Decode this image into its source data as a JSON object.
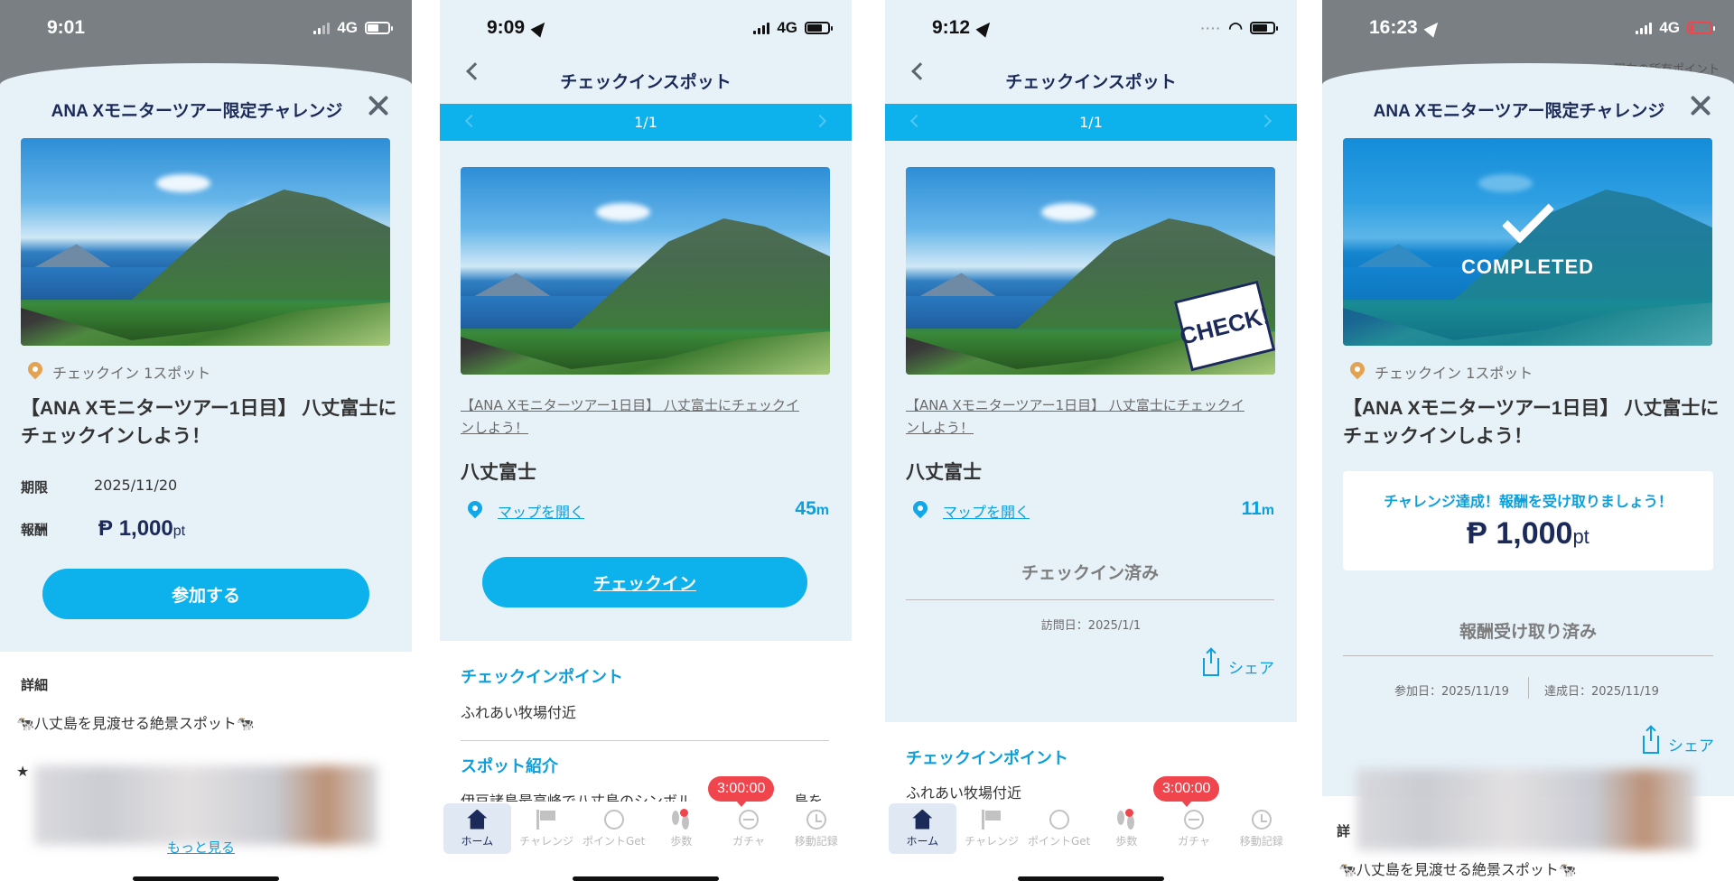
{
  "screens": {
    "join": {
      "time": "9:01",
      "network": "4G",
      "modal_title": "ANA Xモニターツアー限定チャレンジ",
      "spot_count": "チェックイン 1スポット",
      "challenge_title_1": "【ANA Xモニターツアー1日目】 八丈富士に",
      "challenge_title_2": "チェックインしよう！",
      "period_label": "期限",
      "period_value": "2025/11/20",
      "reward_label": "報酬",
      "reward_symbol": "Ᵽ",
      "reward_amount": "1,000",
      "reward_unit": "pt",
      "join_button": "参加する",
      "details_label": "詳細",
      "description": "🐄八丈島を見渡せる絶景スポット🐄",
      "more_link": "もっと見る",
      "star": "★"
    },
    "checkin": {
      "time": "9:09",
      "network": "4G",
      "header_title": "チェックインスポット",
      "pager": "1/1",
      "challenge_link_1": "【ANA Xモニターツアー1日目】 八丈富士にチェックイ",
      "challenge_link_2": "ンしよう！",
      "spot_name": "八丈富士",
      "map_link": "マップを開く",
      "distance_value": "45",
      "distance_unit": "m",
      "checkin_button": "チェックイン",
      "point_title": "チェックインポイント",
      "point_text": "ふれあい牧場付近",
      "intro_title": "スポット紹介",
      "intro_text": "伊豆諸島最高峰で八丈島のシンボル",
      "intro_text_tail": "島を",
      "timer": "3:00:00"
    },
    "checked": {
      "time": "9:12",
      "header_title": "チェックインスポット",
      "pager": "1/1",
      "stamp": "CHECK!",
      "challenge_link_1": "【ANA Xモニターツアー1日目】 八丈富士にチェックイ",
      "challenge_link_2": "ンしよう！",
      "spot_name": "八丈富士",
      "map_link": "マップを開く",
      "distance_value": "11",
      "distance_unit": "m",
      "status": "チェックイン済み",
      "visit_date": "訪問日：2025/1/1",
      "share": "シェア",
      "point_title": "チェックインポイント",
      "point_text": "ふれあい牧場付近",
      "timer": "3:00:00"
    },
    "completed": {
      "time": "16:23",
      "network": "4G",
      "behind_text": "現在の所有ポイント",
      "modal_title": "ANA Xモニターツアー限定チャレンジ",
      "completed_label": "COMPLETED",
      "spot_count": "チェックイン 1スポット",
      "challenge_title_1": "【ANA Xモニターツアー1日目】 八丈富士に",
      "challenge_title_2": "チェックインしよう！",
      "reward_message": "チャレンジ達成！報酬を受け取りましょう！",
      "reward_symbol": "Ᵽ",
      "reward_amount": "1,000",
      "reward_unit": "pt",
      "reward_status": "報酬受け取り済み",
      "joined_date": "参加日：2025/11/19",
      "achieved_date": "達成日：2025/11/19",
      "share": "シェア",
      "details_label": "詳",
      "description": "🐄八丈島を見渡せる絶景スポット🐄"
    }
  },
  "tabbar": {
    "items": [
      {
        "label": "ホーム",
        "icon": "home-icon"
      },
      {
        "label": "チャレンジ",
        "icon": "flag-icon"
      },
      {
        "label": "ポイントGet",
        "icon": "coin-icon"
      },
      {
        "label": "歩数",
        "icon": "footprint-icon"
      },
      {
        "label": "ガチャ",
        "icon": "gacha-icon"
      },
      {
        "label": "移動記録",
        "icon": "clock-icon"
      }
    ]
  },
  "colors": {
    "accent": "#0db1ec",
    "navy": "#1c2a5a",
    "panel_bg": "#e6f1f8",
    "badge_red": "#f0454d"
  }
}
